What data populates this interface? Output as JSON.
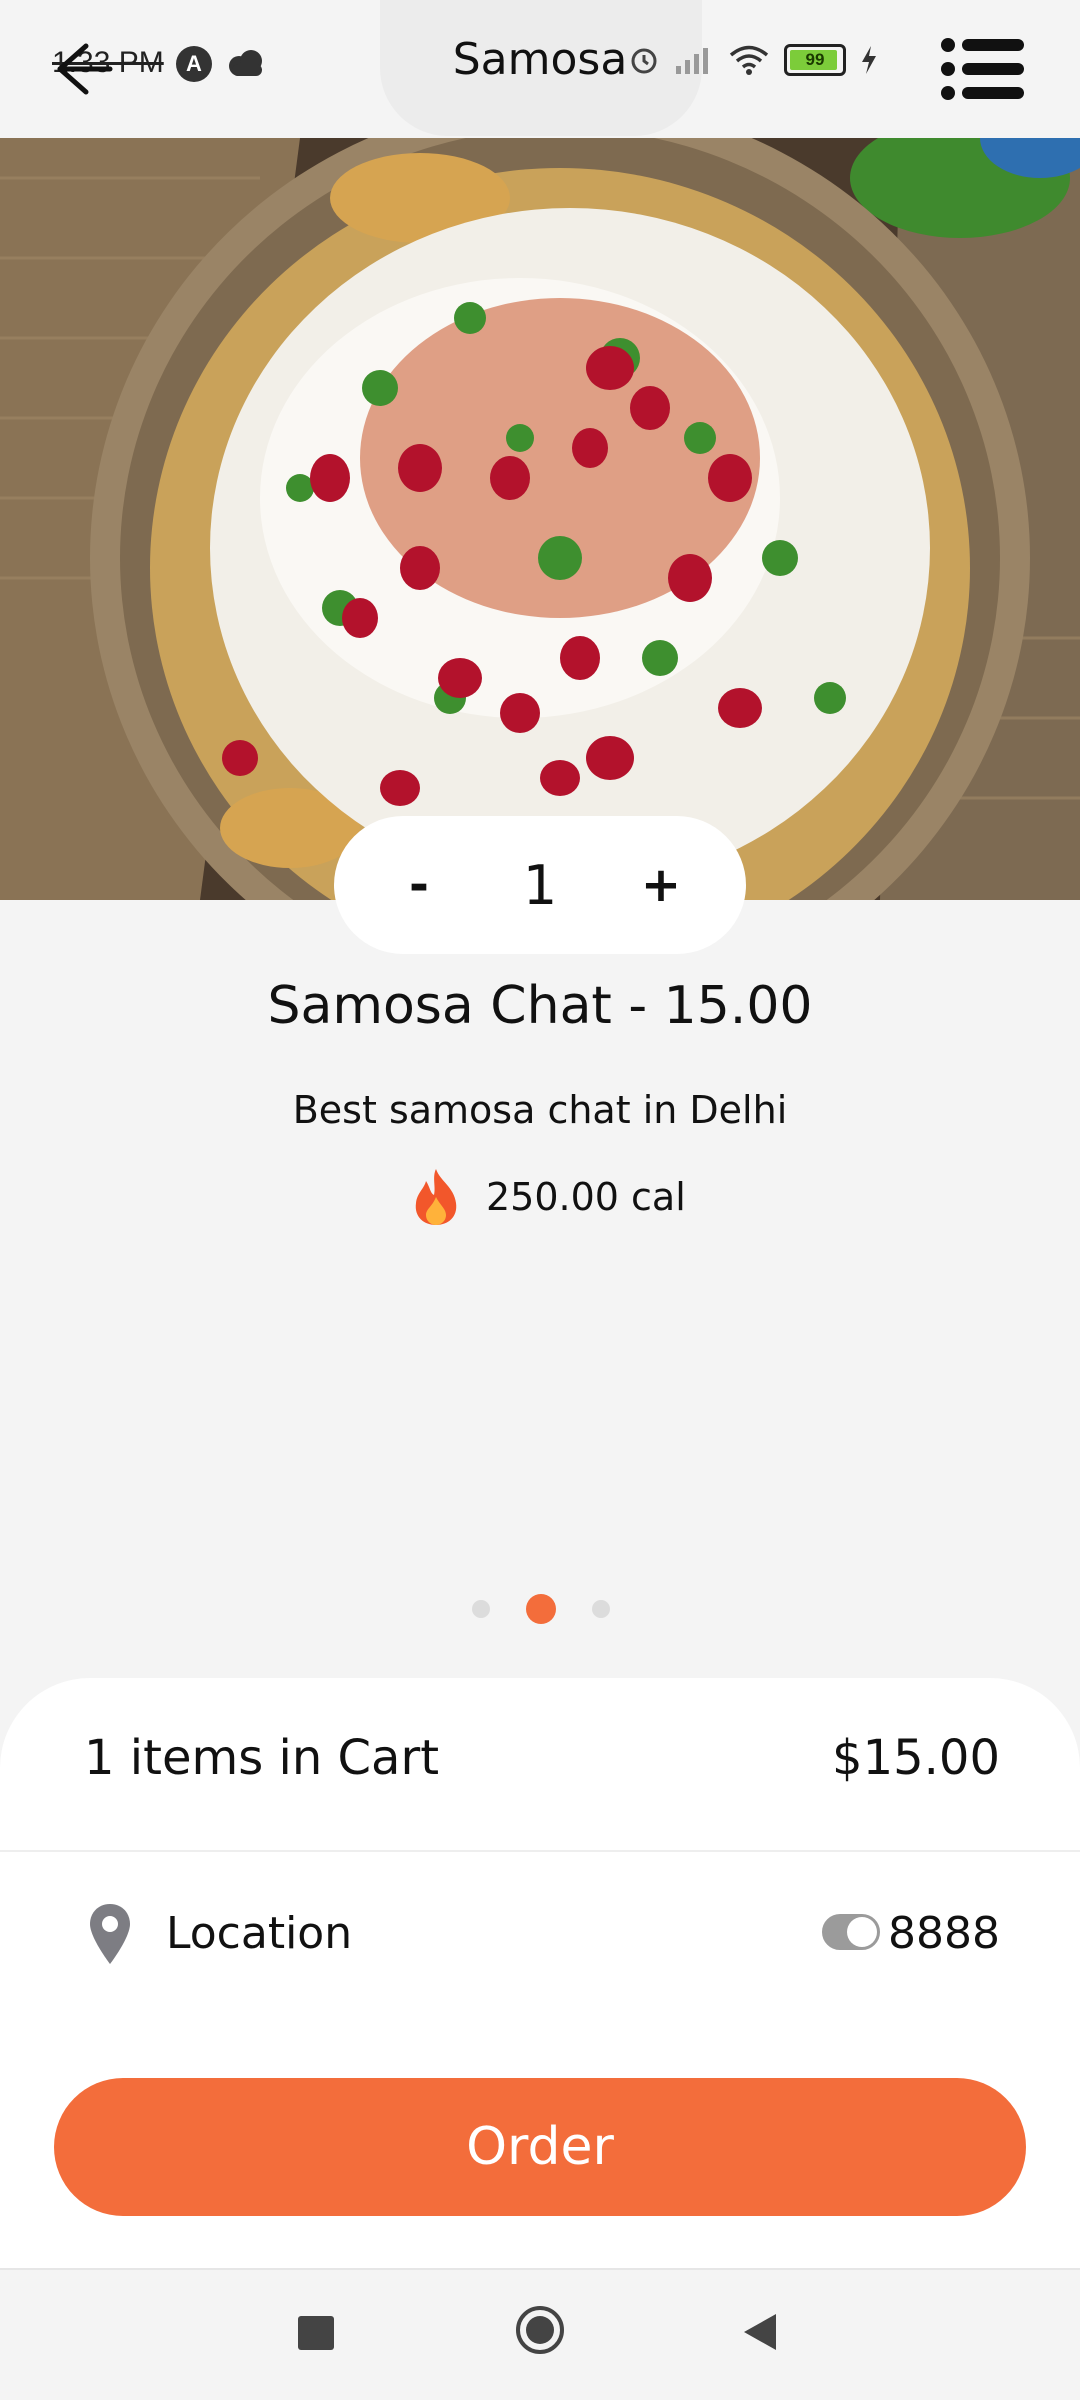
{
  "status_bar": {
    "time": "1:33 PM",
    "left_icons": [
      "a-circle-icon",
      "cloud-icon"
    ],
    "right_icons": [
      "alarm-icon",
      "signal-icon",
      "wifi-icon",
      "battery-icon",
      "charging-icon"
    ],
    "battery_level": "99"
  },
  "header": {
    "title": "Samosa",
    "back_icon": "arrow-left-icon",
    "menu_icon": "list-menu-icon"
  },
  "hero": {
    "image_subject": "samosa chaat bowl"
  },
  "stepper": {
    "minus_label": "-",
    "quantity": "1",
    "plus_label": "+"
  },
  "product": {
    "title": "Samosa Chat - 15.00",
    "description": "Best samosa chat in Delhi",
    "calories": "250.00 cal",
    "calorie_icon": "fire-icon"
  },
  "pager": {
    "count": 3,
    "active_index": 1
  },
  "cart": {
    "items_label": "1 items in Cart",
    "total": "$15.00"
  },
  "location": {
    "label": "Location",
    "value": "8888",
    "icon": "location-pin-icon",
    "toggle_on": true
  },
  "order_button": {
    "label": "Order"
  },
  "colors": {
    "accent": "#f36d3b",
    "background": "#f4f4f4",
    "panel": "#ffffff"
  },
  "navbar": {
    "icons": [
      "recent-apps-icon",
      "home-icon",
      "back-triangle-icon"
    ]
  }
}
